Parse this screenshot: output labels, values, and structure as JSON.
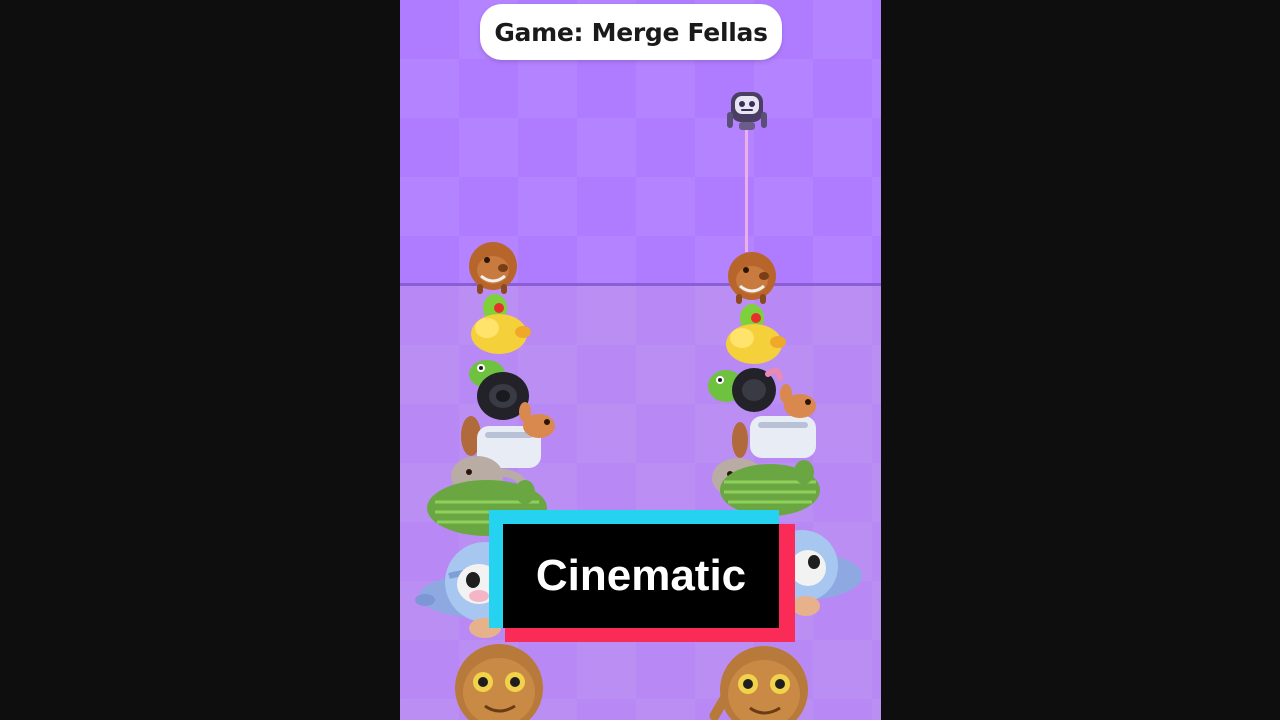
{
  "title": "Game: Merge Fellas",
  "caption": "Cinematic",
  "colors": {
    "background_bars": "#0e0e0e",
    "playfield": "#b07cff",
    "caption_cyan": "#25d3f0",
    "caption_red": "#fb2b57"
  },
  "characters": [
    "capybara-icon",
    "green-parrot-duck-icon",
    "frog-tire-icon",
    "squirrel-toaster-icon",
    "elephant-cucumber-icon",
    "cow-planet-icon",
    "potato-face-icon"
  ]
}
